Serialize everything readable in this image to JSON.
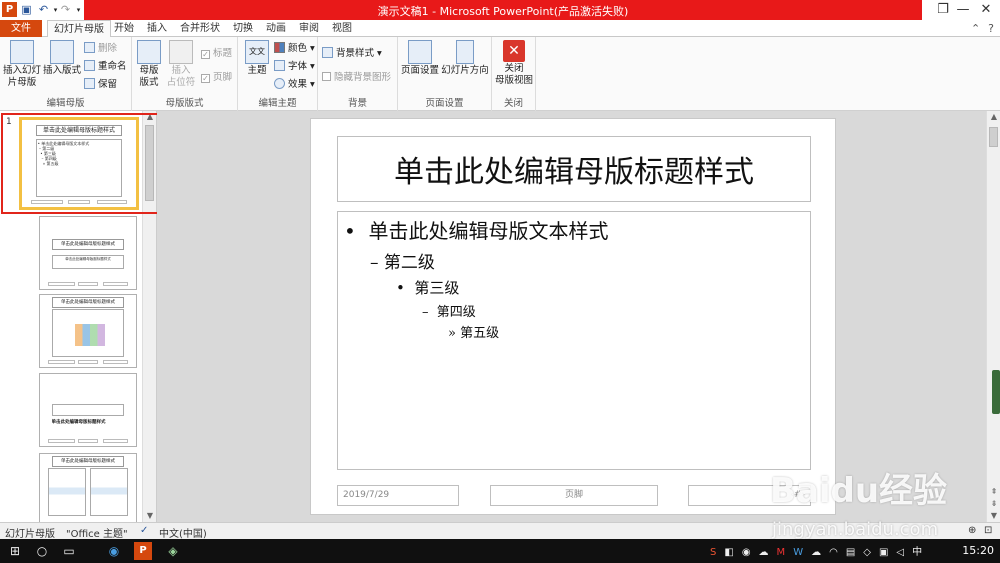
{
  "window": {
    "title": "演示文稿1 - Microsoft PowerPoint(产品激活失败)",
    "controls": {
      "restore": "❐",
      "minimize": "—",
      "close": "✕"
    }
  },
  "tabs": [
    {
      "label": "文件"
    },
    {
      "label": "幻灯片母版"
    },
    {
      "label": "开始"
    },
    {
      "label": "插入"
    },
    {
      "label": "合并形状"
    },
    {
      "label": "切换"
    },
    {
      "label": "动画"
    },
    {
      "label": "审阅"
    },
    {
      "label": "视图"
    }
  ],
  "ribbon": {
    "edit_master": {
      "label": "编辑母版",
      "insert_master": "插入幻灯片母版",
      "insert_master_l1": "插入幻灯",
      "insert_master_l2": "片母版",
      "insert_layout": "插入版式",
      "delete": "删除",
      "rename": "重命名",
      "preserve": "保留"
    },
    "master_layout": {
      "label": "母版版式",
      "master_layout_l1": "母版",
      "master_layout_l2": "版式",
      "insert_placeholder_l1": "插入",
      "insert_placeholder_l2": "占位符",
      "title": "标题",
      "footer": "页脚"
    },
    "edit_theme": {
      "label": "编辑主题",
      "theme": "主题",
      "colors": "颜色",
      "fonts": "字体",
      "effects": "效果"
    },
    "background": {
      "label": "背景",
      "bg_styles": "背景样式",
      "hide_bg": "隐藏背景图形"
    },
    "page_setup": {
      "label": "页面设置",
      "page_setup": "页面设置",
      "orientation": "幻灯片方向"
    },
    "close": {
      "label": "关闭",
      "close_l1": "关闭",
      "close_l2": "母版视图"
    }
  },
  "thumbnails": [
    {
      "number": "1",
      "title": "单击此处编辑母版标题样式",
      "selected": true
    },
    {
      "number": "",
      "title": "单击此处编辑母版标题样式",
      "subtitle": "单击此处编辑母版副标题样式"
    },
    {
      "number": "",
      "title": "单击此处编辑母版标题样式"
    },
    {
      "number": "",
      "title": "单击此处编辑母版标题样式"
    },
    {
      "number": "",
      "title": "单击此处编辑母版标题样式"
    }
  ],
  "slide": {
    "title": "单击此处编辑母版标题样式",
    "levels": [
      {
        "bullet": "•",
        "text": "单击此处编辑母版文本样式"
      },
      {
        "bullet": "–",
        "text": "第二级"
      },
      {
        "bullet": "•",
        "text": "第三级"
      },
      {
        "bullet": "–",
        "text": "第四级"
      },
      {
        "bullet": "»",
        "text": "第五级"
      }
    ],
    "date": "2019/7/29",
    "footer": "页脚",
    "page_number": "‹#›"
  },
  "statusbar": {
    "view": "幻灯片母版",
    "theme": "\"Office 主题\"",
    "language": "中文(中国)"
  },
  "taskbar": {
    "time": "15:20"
  },
  "watermark": {
    "brand": "Baidu经验",
    "url": "jingyan.baidu.com"
  },
  "colors": {
    "titlebar_accent": "#e81919",
    "file_tab": "#d5480e",
    "annotation": "#e1251b",
    "selected_thumb": "#f3c042"
  }
}
